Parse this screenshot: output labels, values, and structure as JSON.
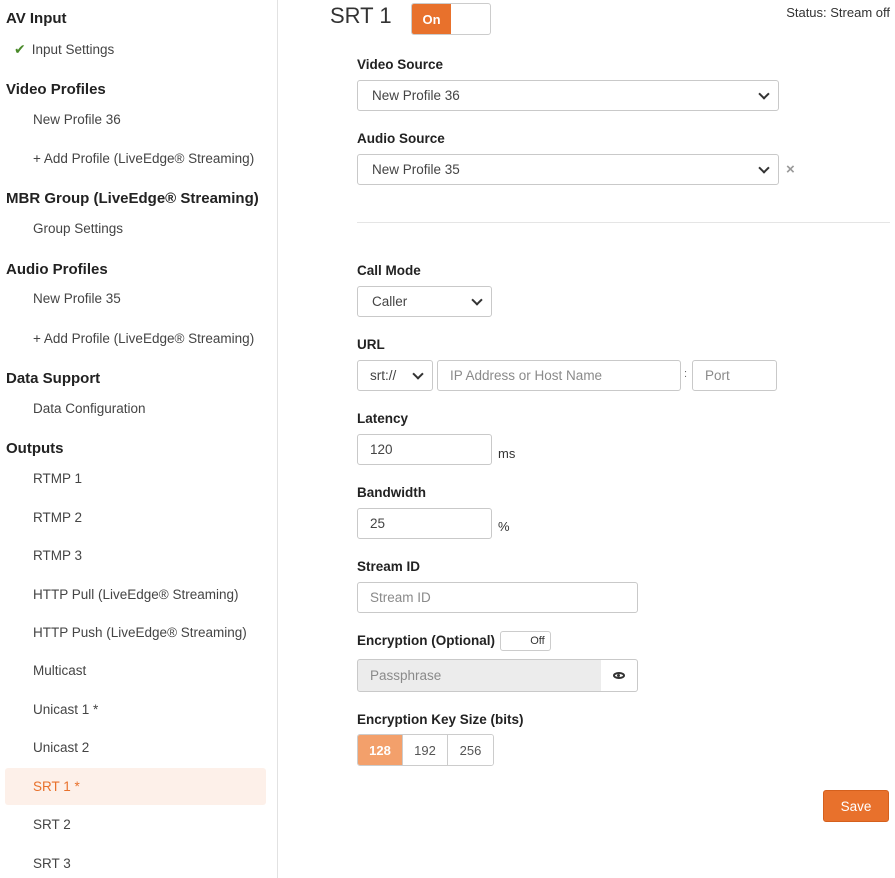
{
  "sidebar": {
    "av_input": {
      "title": "AV Input",
      "items": [
        "Input Settings"
      ]
    },
    "video_profiles": {
      "title": "Video Profiles",
      "items": [
        "New Profile 36",
        "+ Add Profile (LiveEdge® Streaming)"
      ]
    },
    "mbr_group": {
      "title": "MBR Group (LiveEdge® Streaming)",
      "items": [
        "Group Settings"
      ]
    },
    "audio_profiles": {
      "title": "Audio Profiles",
      "items": [
        "New Profile 35",
        "+ Add Profile (LiveEdge® Streaming)"
      ]
    },
    "data_support": {
      "title": "Data Support",
      "items": [
        "Data Configuration"
      ]
    },
    "outputs": {
      "title": "Outputs",
      "items": [
        "RTMP 1",
        "RTMP 2",
        "RTMP 3",
        "HTTP Pull (LiveEdge® Streaming)",
        "HTTP Push (LiveEdge® Streaming)",
        "Multicast",
        "Unicast 1 *",
        "Unicast 2",
        "SRT 1 *",
        "SRT 2",
        "SRT 3"
      ],
      "active_item": "SRT 1 *"
    }
  },
  "main": {
    "title": "SRT 1",
    "enable_toggle": "On",
    "status": "Status: Stream off",
    "video_source": {
      "label": "Video Source",
      "value": "New Profile 36"
    },
    "audio_source": {
      "label": "Audio Source",
      "value": "New Profile 35",
      "clear": "×"
    },
    "call_mode": {
      "label": "Call Mode",
      "value": "Caller"
    },
    "url": {
      "label": "URL",
      "scheme": "srt://",
      "host_placeholder": "IP Address or Host Name",
      "separator": ":",
      "port_placeholder": "Port"
    },
    "latency": {
      "label": "Latency",
      "value": "120",
      "unit": "ms"
    },
    "bandwidth": {
      "label": "Bandwidth",
      "value": "25",
      "unit": "%"
    },
    "stream_id": {
      "label": "Stream ID",
      "placeholder": "Stream ID"
    },
    "encryption": {
      "label": "Encryption (Optional)",
      "toggle": "Off",
      "passphrase_placeholder": "Passphrase"
    },
    "key_size": {
      "label": "Encryption Key Size (bits)",
      "options": [
        "128",
        "192",
        "256"
      ],
      "selected": "128"
    },
    "save_label": "Save"
  },
  "colors": {
    "accent": "#e8712c",
    "active_bg": "#fdf0e9",
    "check": "#4a8a2a"
  },
  "icons": {
    "check": "check-icon",
    "chevron": "chevron-down-icon",
    "clear": "close-icon",
    "eye": "eye-icon"
  }
}
